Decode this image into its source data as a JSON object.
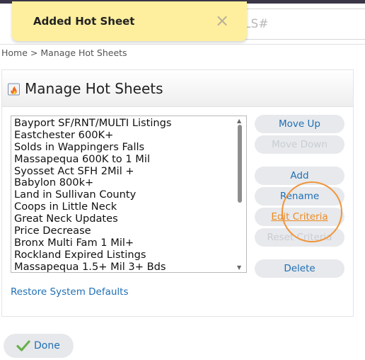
{
  "toast": {
    "message": "Added Hot Sheet",
    "close_glyph": "×"
  },
  "search": {
    "placeholder_fragment": "LS#"
  },
  "breadcrumb": {
    "home": "Home",
    "separator": ">",
    "current": "Manage Hot Sheets"
  },
  "panel": {
    "title": "Manage Hot Sheets",
    "icon": "hot-sheet-fire-icon"
  },
  "hot_sheets": [
    "Bayport SF/RNT/MULTI Listings",
    "Eastchester 600K+",
    "Solds in Wappingers Falls",
    "Massapequa 600K to 1 Mil",
    "Syosset Act SFH 2Mil +",
    "Babylon 800k+",
    "Land in Sullivan County",
    "Coops in Little Neck",
    "Great Neck Updates",
    "Price Decrease",
    "Bronx Multi Fam 1 Mil+",
    "Rockland Expired Listings",
    "Massapequa 1.5+ Mil 3+ Bds"
  ],
  "buttons": {
    "move_up": "Move Up",
    "move_down": "Move Down",
    "add": "Add",
    "rename": "Rename",
    "edit_criteria": "Edit Criteria",
    "reset_criteria": "Reset Criteria"
  },
  "delete_label": "Delete",
  "restore_label": "Restore System Defaults",
  "done_label": "Done",
  "colors": {
    "toast_bg": "#fdef9e",
    "link_blue": "#1f6fb5",
    "highlight_orange": "#f0953a",
    "done_check": "#6ab04c"
  }
}
